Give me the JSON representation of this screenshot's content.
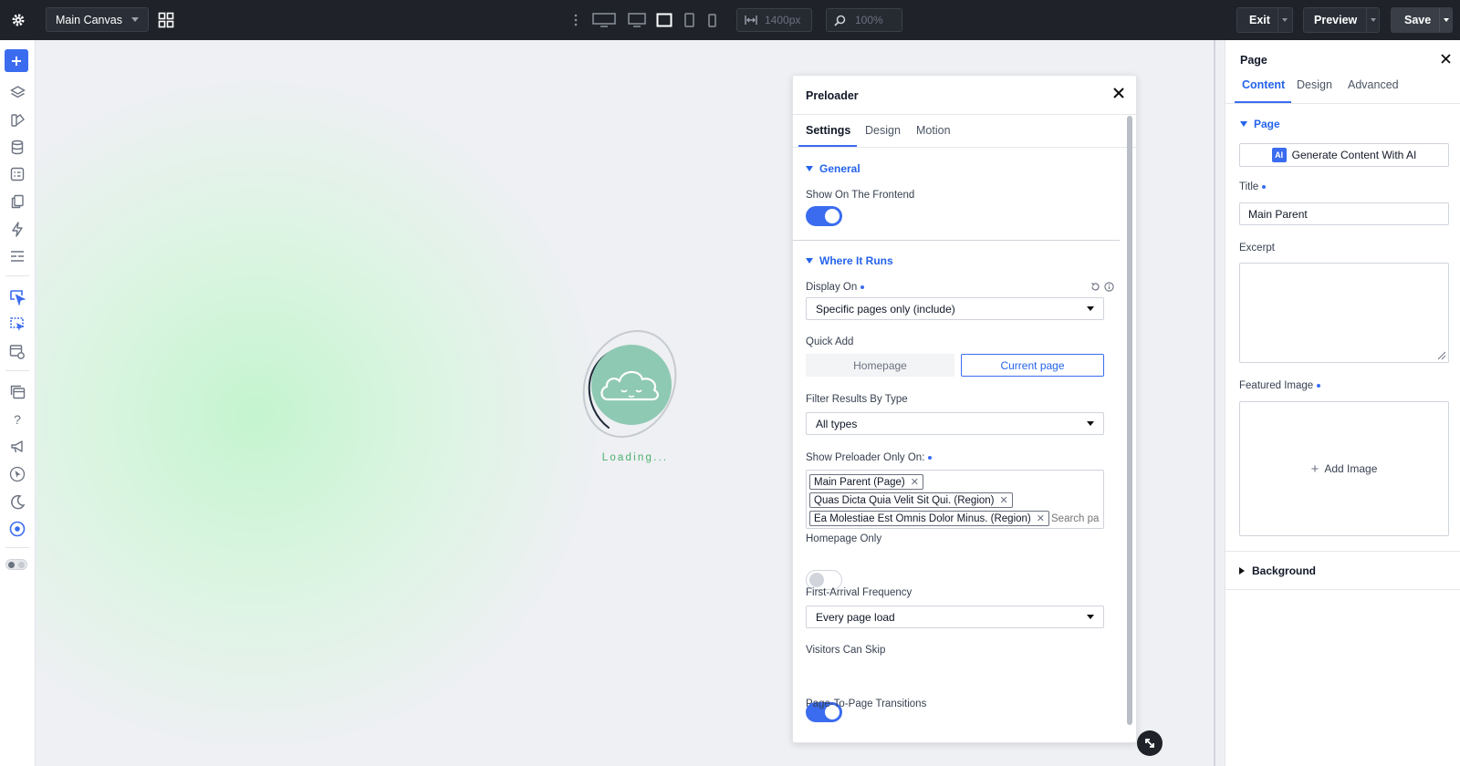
{
  "topbar": {
    "canvas_select": "Main Canvas",
    "width_value": "1400px",
    "zoom_value": "100%",
    "exit_label": "Exit",
    "preview_label": "Preview",
    "save_label": "Save"
  },
  "canvas": {
    "loading_text": "Loading..."
  },
  "popup": {
    "title": "Preloader",
    "tabs": [
      "Settings",
      "Design",
      "Motion"
    ],
    "general": {
      "title": "General",
      "show_frontend_label": "Show On The Frontend",
      "show_frontend_on": true
    },
    "where": {
      "title": "Where It Runs",
      "display_on_label": "Display On",
      "display_on_value": "Specific pages only (include)",
      "quick_add_label": "Quick Add",
      "quick_add_options": [
        "Homepage",
        "Current page"
      ],
      "filter_label": "Filter Results By Type",
      "filter_value": "All types",
      "show_only_label": "Show Preloader Only On:",
      "chips": [
        "Main Parent (Page)",
        "Quas Dicta Quia Velit Sit Qui. (Region)",
        "Ea Molestiae Est Omnis Dolor Minus. (Region)"
      ],
      "search_placeholder": "Search pa",
      "homepage_only_label": "Homepage Only",
      "homepage_only_on": false,
      "frequency_label": "First-Arrival Frequency",
      "frequency_value": "Every page load",
      "skip_label": "Visitors Can Skip",
      "skip_on": true,
      "transitions_label": "Page-To-Page Transitions",
      "transitions_on": true
    }
  },
  "rpanel": {
    "title": "Page",
    "tabs": [
      "Content",
      "Design",
      "Advanced"
    ],
    "section_title": "Page",
    "ai_button": "Generate Content With AI",
    "ai_badge": "AI",
    "title_label": "Title",
    "title_value": "Main Parent",
    "excerpt_label": "Excerpt",
    "featured_label": "Featured Image",
    "add_image": "Add Image",
    "background_label": "Background"
  },
  "colors": {
    "accent": "#3b6cf0",
    "topbar": "#1f2329",
    "cloud": "#8ec9b3"
  }
}
